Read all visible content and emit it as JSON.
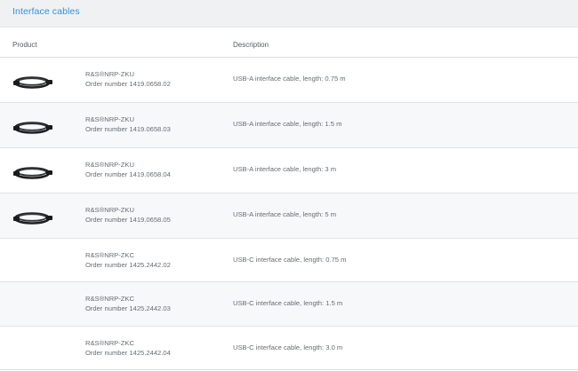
{
  "section": {
    "title": "Interface cables"
  },
  "table": {
    "headers": {
      "product": "Product",
      "description": "Description"
    },
    "rows": [
      {
        "product": "R&S®NRP-ZKU",
        "order": "Order number 1419.0658.02",
        "description": "USB-A interface cable, length: 0.75 m",
        "image": "usb-cable-image"
      },
      {
        "product": "R&S®NRP-ZKU",
        "order": "Order number 1419.0658.03",
        "description": "USB-A interface cable, length: 1.5 m",
        "image": "usb-cable-image"
      },
      {
        "product": "R&S®NRP-ZKU",
        "order": "Order number 1419.0658.04",
        "description": "USB-A interface cable, length: 3 m",
        "image": "usb-cable-image"
      },
      {
        "product": "R&S®NRP-ZKU",
        "order": "Order number 1419.0658.05",
        "description": "USB-A interface cable, length: 5 m",
        "image": "usb-cable-image"
      },
      {
        "product": "R&S®NRP-ZKC",
        "order": "Order number 1425.2442.02",
        "description": "USB-C interface cable, length: 0.75 m",
        "image": ""
      },
      {
        "product": "R&S®NRP-ZKC",
        "order": "Order number 1425.2442.03",
        "description": "USB-C interface cable, length: 1.5 m",
        "image": ""
      },
      {
        "product": "R&S®NRP-ZKC",
        "order": "Order number 1425.2442.04",
        "description": "USB-C interface cable, length: 3.0 m",
        "image": ""
      }
    ]
  },
  "colors": {
    "accent": "#3c8fd0",
    "header_bg": "#eff1f3",
    "alt_row_bg": "#f7f8f9"
  }
}
